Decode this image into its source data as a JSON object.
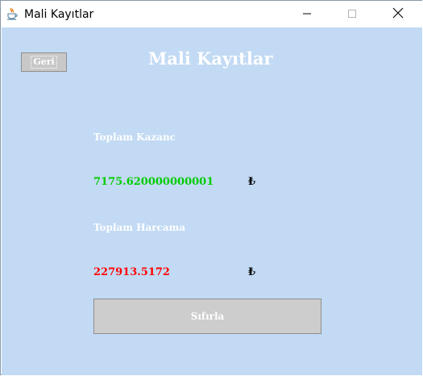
{
  "window": {
    "title": "Mali Kayıtlar"
  },
  "page": {
    "back_label": "Geri",
    "heading": "Mali Kayıtlar",
    "earnings_label": "Toplam Kazanc",
    "earnings_value": "7175.620000000001",
    "expenses_label": "Toplam Harcama",
    "expenses_value": "227913.5172",
    "currency_symbol": "₺",
    "reset_label": "Sıfırla"
  },
  "colors": {
    "background": "#c2daf4",
    "earnings_value": "#00cc00",
    "expenses_value": "#ff0000",
    "button": "#cdcdcd"
  },
  "icons": {
    "app": "java-coffee-cup-icon",
    "minimize": "minimize-icon",
    "maximize": "maximize-icon",
    "close": "close-icon"
  }
}
